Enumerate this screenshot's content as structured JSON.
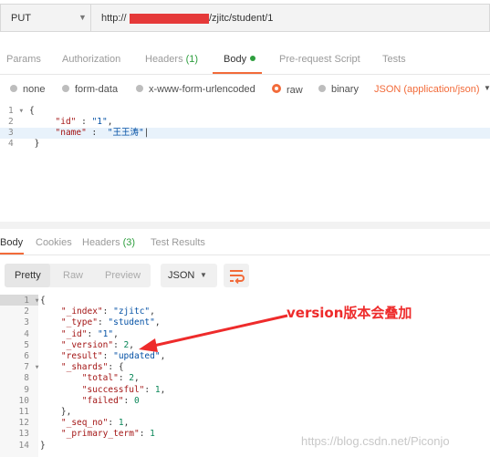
{
  "request": {
    "method": "PUT",
    "url_prefix": "http://",
    "url_suffix": "/zjitc/student/1"
  },
  "tabs": {
    "params": "Params",
    "authorization": "Authorization",
    "headers": "Headers",
    "headers_count": "(1)",
    "body": "Body",
    "prerequest": "Pre-request Script",
    "tests": "Tests"
  },
  "body_types": {
    "none": "none",
    "form_data": "form-data",
    "urlencoded": "x-www-form-urlencoded",
    "raw": "raw",
    "binary": "binary",
    "json_type": "JSON (application/json)"
  },
  "request_body": {
    "line_numbers": [
      "1",
      "2",
      "3",
      "4"
    ],
    "open": "{",
    "id_key": "\"id\"",
    "id_sep": " : ",
    "id_val": "\"1\"",
    "name_key": "\"name\"",
    "name_sep": " :  ",
    "name_val": "\"王王涛\"",
    "close": "}"
  },
  "response_tabs": {
    "body": "Body",
    "cookies": "Cookies",
    "headers": "Headers",
    "headers_count": "(3)",
    "test_results": "Test Results"
  },
  "response_toolbar": {
    "pretty": "Pretty",
    "raw": "Raw",
    "preview": "Preview",
    "format": "JSON"
  },
  "response_lines": [
    {
      "n": "1",
      "text": "{"
    },
    {
      "n": "2",
      "text": "    \"_index\": \"zjitc\","
    },
    {
      "n": "3",
      "text": "    \"_type\": \"student\","
    },
    {
      "n": "4",
      "text": "    \"_id\": \"1\","
    },
    {
      "n": "5",
      "text": "    \"_version\": 2,"
    },
    {
      "n": "6",
      "text": "    \"result\": \"updated\","
    },
    {
      "n": "7",
      "text": "    \"_shards\": {"
    },
    {
      "n": "8",
      "text": "        \"total\": 2,"
    },
    {
      "n": "9",
      "text": "        \"successful\": 1,"
    },
    {
      "n": "10",
      "text": "        \"failed\": 0"
    },
    {
      "n": "11",
      "text": "    },"
    },
    {
      "n": "12",
      "text": "    \"_seq_no\": 1,"
    },
    {
      "n": "13",
      "text": "    \"_primary_term\": 1"
    },
    {
      "n": "14",
      "text": "}"
    }
  ],
  "annotation": "version版本会叠加",
  "watermark": "https://blog.csdn.net/Piconjo",
  "colors": {
    "accent": "#f26b3a",
    "annotation": "#ee2b2b",
    "status_green": "#2e9e3e"
  }
}
